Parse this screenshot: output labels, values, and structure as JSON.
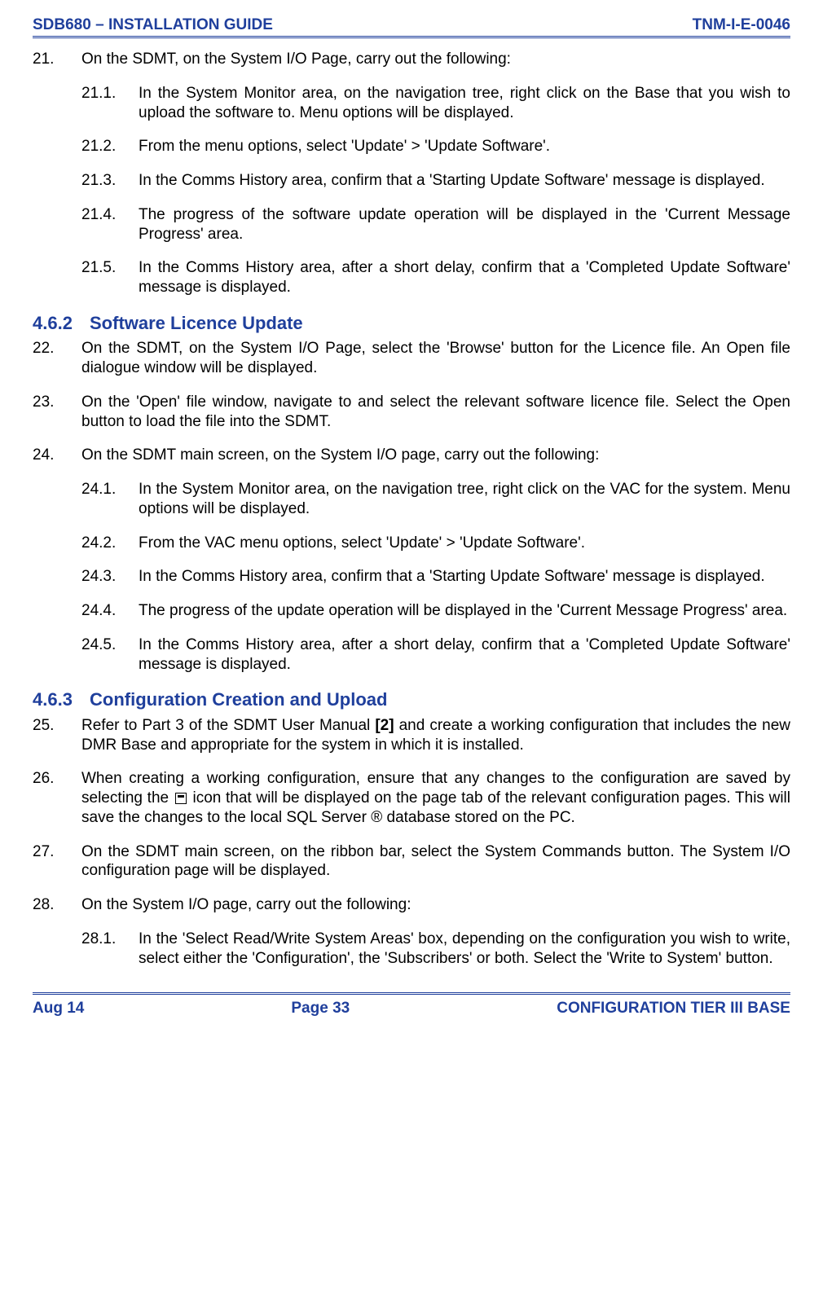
{
  "header": {
    "left": "SDB680 – INSTALLATION GUIDE",
    "right": "TNM-I-E-0046"
  },
  "footer": {
    "left": "Aug 14",
    "center": "Page 33",
    "right": "CONFIGURATION TIER III BASE"
  },
  "b21": {
    "num": "21.",
    "text": "On the SDMT, on the System I/O Page, carry out the following:",
    "s1": {
      "num": "21.1.",
      "text": "In the System Monitor area, on the navigation tree, right click on the Base that you wish to upload the software to.  Menu options will be displayed."
    },
    "s2": {
      "num": "21.2.",
      "text": "From the menu options, select 'Update' > 'Update Software'."
    },
    "s3": {
      "num": "21.3.",
      "text": "In the Comms History area, confirm that a 'Starting Update Software' message is displayed."
    },
    "s4": {
      "num": "21.4.",
      "text": "The progress of the software update operation will be displayed in the 'Current Message Progress' area."
    },
    "s5": {
      "num": "21.5.",
      "text": "In the Comms History area, after a short delay, confirm that a 'Completed Update Software' message is displayed."
    }
  },
  "sec462": {
    "num": "4.6.2",
    "title": "Software Licence Update"
  },
  "b22": {
    "num": "22.",
    "text": "On the SDMT, on the System I/O Page, select the 'Browse' button for the Licence file.  An Open file dialogue window will be displayed."
  },
  "b23": {
    "num": "23.",
    "text": "On the 'Open' file window, navigate to and select the relevant software licence file.  Select the Open button to load the file into the SDMT."
  },
  "b24": {
    "num": "24.",
    "text": "On the SDMT main screen, on the System I/O page, carry out the following:",
    "s1": {
      "num": "24.1.",
      "text": "In the System Monitor area, on the navigation tree, right click on the VAC for the system.  Menu options will be displayed."
    },
    "s2": {
      "num": "24.2.",
      "text": "From the VAC menu options, select 'Update' > 'Update Software'."
    },
    "s3": {
      "num": "24.3.",
      "text": "In the Comms History area, confirm that a 'Starting Update Software' message is displayed."
    },
    "s4": {
      "num": "24.4.",
      "text": "The progress of the update operation will be displayed in the 'Current Message Progress' area."
    },
    "s5": {
      "num": "24.5.",
      "text": "In the Comms History area, after a short delay, confirm that a 'Completed Update Software' message is displayed."
    }
  },
  "sec463": {
    "num": "4.6.3",
    "title": "Configuration Creation and Upload"
  },
  "b25": {
    "num": "25.",
    "pre": "Refer to Part 3 of the SDMT User Manual ",
    "ref": "[2]",
    "post": " and create a working configuration that includes the new DMR Base and appropriate for the system in which it is installed."
  },
  "b26": {
    "num": "26.",
    "pre": "When creating a working configuration, ensure that any changes to the configuration are saved by selecting the ",
    "post": " icon that will be displayed on the page tab of the relevant configuration pages.  This will save the changes to the local SQL Server ® database stored on the PC."
  },
  "b27": {
    "num": "27.",
    "text": "On the SDMT main screen, on the ribbon bar, select the System Commands button.  The System I/O configuration page will be displayed."
  },
  "b28": {
    "num": "28.",
    "text": "On the System I/O page, carry out the following:",
    "s1": {
      "num": "28.1.",
      "text": "In the 'Select Read/Write System Areas' box, depending on the configuration you wish to write, select either the 'Configuration', the 'Subscribers' or both.  Select the 'Write to System' button."
    }
  }
}
